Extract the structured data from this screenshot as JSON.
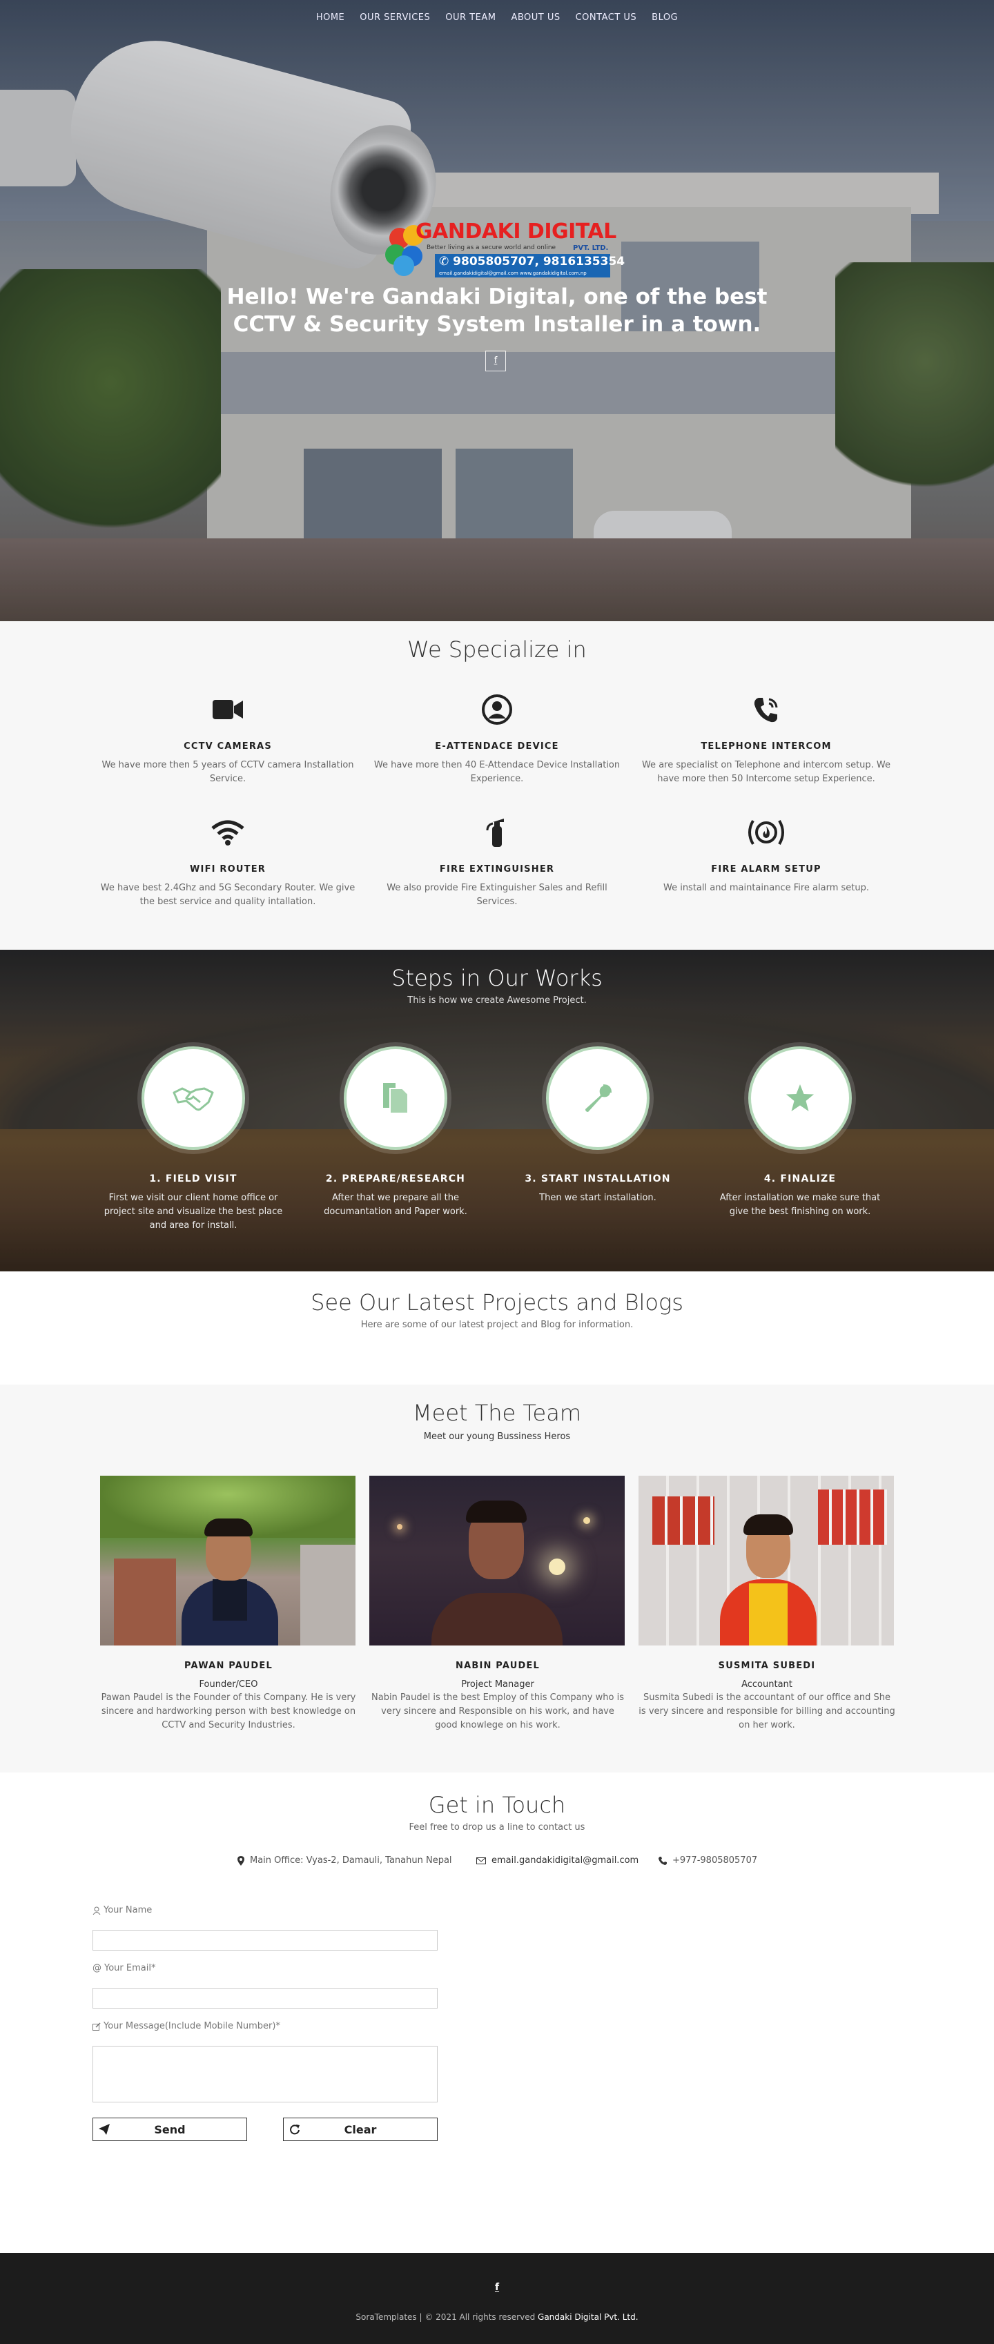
{
  "nav": {
    "items": [
      "HOME",
      "OUR SERVICES",
      "OUR TEAM",
      "ABOUT US",
      "CONTACT US",
      "BLOG"
    ]
  },
  "hero": {
    "logo": {
      "title": "GANDAKI DIGITAL",
      "tagline": "Better living as a secure world and online",
      "ltd": "PVT. LTD.",
      "phone": "9805805707, 9816135354",
      "email": "email.gandakidigital@gmail.com   www.gandakidigital.com.np"
    },
    "heading_line1": "Hello! We're Gandaki Digital, one of the best",
    "heading_line2": "CCTV & Security System Installer in a town.",
    "fb_glyph": "f"
  },
  "specialize": {
    "title": "We Specialize in",
    "items": [
      {
        "icon": "video-camera-icon",
        "name": "CCTV CAMERAS",
        "desc": "We have more then 5 years of CCTV camera Installation Service."
      },
      {
        "icon": "user-circle-icon",
        "name": "E-ATTENDACE DEVICE",
        "desc": "We have more then 40 E-Attendace Device Installation Experience."
      },
      {
        "icon": "phone-volume-icon",
        "name": "TELEPHONE INTERCOM",
        "desc": "We are specialist on Telephone and intercom setup. We have more then 50 Intercome setup Experience."
      },
      {
        "icon": "wifi-icon",
        "name": "WIFI ROUTER",
        "desc": "We have best 2.4Ghz and 5G Secondary Router. We give the best service and quality intallation."
      },
      {
        "icon": "fire-extinguisher-icon",
        "name": "FIRE EXTINGUISHER",
        "desc": "We also provide Fire Extinguisher Sales and Refill Services."
      },
      {
        "icon": "fire-alarm-icon",
        "name": "FIRE ALARM SETUP",
        "desc": "We install and maintainance Fire alarm setup."
      }
    ]
  },
  "steps": {
    "title": "Steps in Our Works",
    "subtitle": "This is how we create Awesome Project.",
    "items": [
      {
        "icon": "handshake-icon",
        "name": "1. FIELD VISIT",
        "desc": "First we visit our client home office or project site and visualize the best place and area for install."
      },
      {
        "icon": "documents-icon",
        "name": "2. PREPARE/RESEARCH",
        "desc": "After that we prepare all the documantation and Paper work."
      },
      {
        "icon": "wrench-icon",
        "name": "3. START INSTALLATION",
        "desc": "Then we start installation."
      },
      {
        "icon": "star-icon",
        "name": "4. FINALIZE",
        "desc": "After installation we make sure that give the best finishing on work."
      }
    ]
  },
  "projects": {
    "title": "See Our Latest Projects and Blogs",
    "subtitle": "Here are some of our latest project and Blog for information."
  },
  "team": {
    "title": "Meet The Team",
    "subtitle": "Meet our young Bussiness Heros",
    "members": [
      {
        "name": "PAWAN PAUDEL",
        "role": "Founder/CEO",
        "desc": "Pawan Paudel is the Founder of this Company. He is very sincere and hardworking person with best knowledge on CCTV and Security Industries."
      },
      {
        "name": "NABIN PAUDEL",
        "role": "Project Manager",
        "desc": "Nabin Paudel is the best Employ of this Company who is very sincere and Responsible on his work, and have good knowlege on his work."
      },
      {
        "name": "SUSMITA SUBEDI",
        "role": "Accountant",
        "desc": "Susmita Subedi is the accountant of our office and She is very sincere and responsible for billing and accounting on her work."
      }
    ]
  },
  "contact": {
    "title": "Get in Touch",
    "subtitle": "Feel free to drop us a line to contact us",
    "address": "Main Office: Vyas-2, Damauli, Tanahun Nepal",
    "email": "email.gandakidigital@gmail.com",
    "phone": "+977-9805805707",
    "form": {
      "name_label": "Your Name",
      "name_value": "",
      "email_label": "Your Email*",
      "email_value": "",
      "message_label": "Your Message(Include Mobile Number)*",
      "message_value": "",
      "send_label": "Send",
      "clear_label": "Clear"
    }
  },
  "footer": {
    "fb_glyph": "f",
    "copy_prefix": "SoraTemplates | © 2021 All rights reserved ",
    "copy_brand": "Gandaki Digital Pvt. Ltd."
  },
  "colors": {
    "accent_green": "#8fc79a",
    "footer_bg": "#1c1c1c",
    "logo_red": "#e62020",
    "logo_blue": "#1a66b3"
  }
}
